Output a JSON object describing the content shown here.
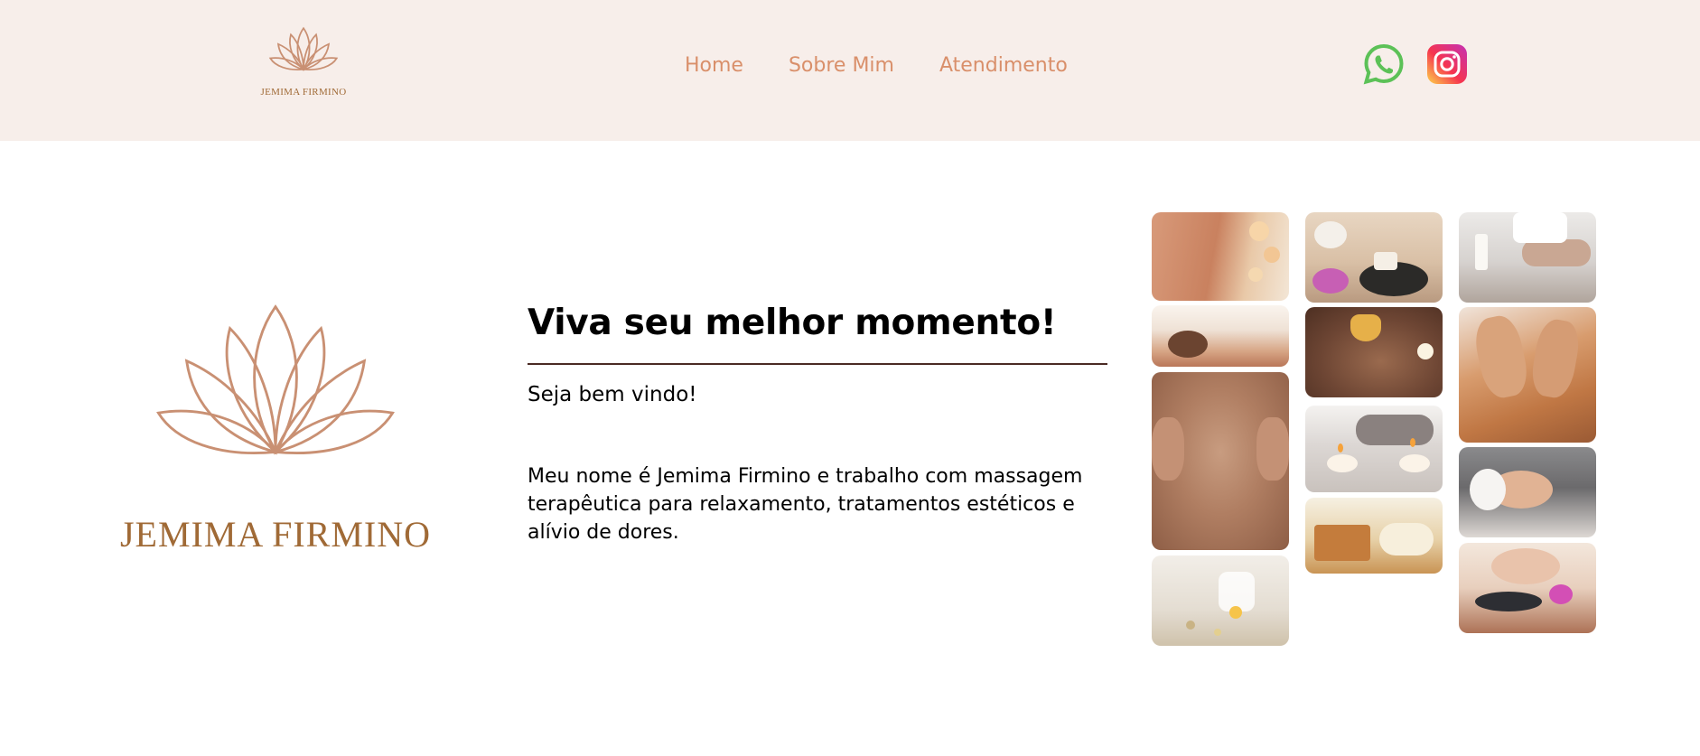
{
  "header": {
    "logo_text": "JEMIMA FIRMINO",
    "nav": [
      {
        "label": "Home"
      },
      {
        "label": "Sobre Mim"
      },
      {
        "label": "Atendimento"
      }
    ],
    "social": [
      {
        "icon": "whatsapp-icon",
        "color": "#5cc157"
      },
      {
        "icon": "instagram-icon",
        "color": "#e1306c"
      }
    ],
    "background": "#f7eeea",
    "accent": "#d98f6a"
  },
  "brand": {
    "name": "JEMIMA FIRMINO",
    "icon": "lotus-icon",
    "color": "#c99073"
  },
  "intro": {
    "title": "Viva seu melhor momento!",
    "welcome": "Seja bem vindo!",
    "body": "Meu nome é Jemima Firmino e trabalho com massagem terapêutica para relaxamento, tratamentos estéticos e alívio de dores."
  },
  "gallery": {
    "photos": [
      {
        "name": "photo-back-massage-orchids"
      },
      {
        "name": "photo-woman-relaxing-massage"
      },
      {
        "name": "photo-back-massage-close"
      },
      {
        "name": "photo-oil-bottles"
      },
      {
        "name": "photo-candle-stones"
      },
      {
        "name": "photo-oil-pouring-hands"
      },
      {
        "name": "photo-candles-towels"
      },
      {
        "name": "photo-soap-towel"
      },
      {
        "name": "photo-candle-massage-table"
      },
      {
        "name": "photo-hands-massage-oil"
      },
      {
        "name": "photo-facial-treatment"
      },
      {
        "name": "photo-woman-stones-orchid"
      }
    ]
  }
}
